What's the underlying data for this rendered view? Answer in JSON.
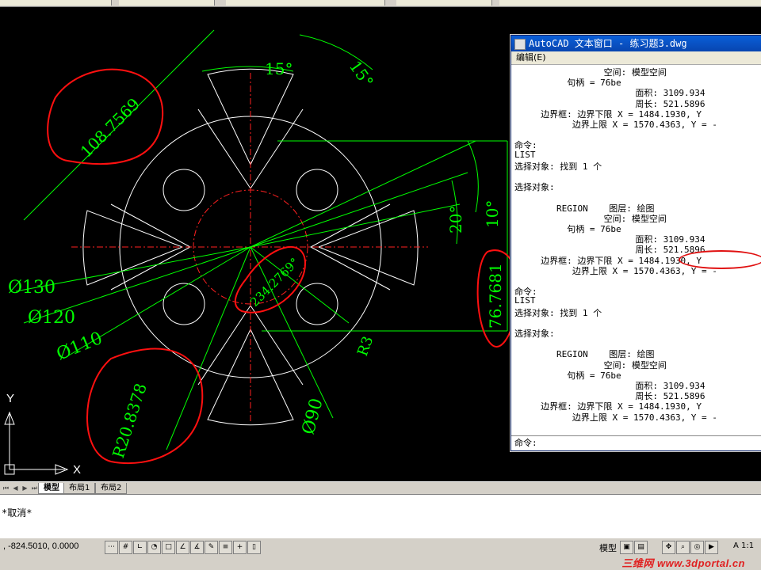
{
  "drawing": {
    "dims": {
      "d130": "Ø130",
      "d120": "Ø120",
      "d110": "Ø110",
      "d90": "Ø90",
      "r3": "R3",
      "r20": "R20.8378",
      "len108": "108.7569",
      "len234": "234.2769°",
      "len76": "76.7681",
      "ang15a": "15°",
      "ang15b": "15°",
      "ang20": "20°",
      "ang10": "10°"
    },
    "ucs": {
      "x": "X",
      "y": "Y"
    },
    "colors": {
      "geometry": "#ffffff",
      "dims": "#00ff00",
      "center": "#ff2020",
      "annot": "#ff1010"
    }
  },
  "tabs": {
    "model": "模型",
    "layout1": "布局1",
    "layout2": "布局2"
  },
  "cmdline": {
    "line1": "*取消*"
  },
  "status": {
    "coords": ", -824.5010, 0.0000",
    "model": "模型",
    "scale": "A 1:1",
    "watermark": "三维网 www.3dportal.cn"
  },
  "textwin": {
    "title": "AutoCAD 文本窗口 - 练习题3.dwg",
    "menu": "编辑(E)",
    "lines": [
      "                 空间: 模型空间",
      "          句柄 = 76be",
      "                       面积: 3109.934",
      "                       周长: 521.5896",
      "     边界框: 边界下限 X = 1484.1930, Y",
      "           边界上限 X = 1570.4363, Y = -",
      "",
      "命令:",
      "LIST",
      "选择对象: 找到 1 个",
      "",
      "选择对象:",
      "",
      "        REGION    图层: 绘图",
      "                 空间: 模型空间",
      "          句柄 = 76be",
      "                       面积: 3109.934",
      "                       周长: 521.5896",
      "     边界框: 边界下限 X = 1484.1930, Y",
      "           边界上限 X = 1570.4363, Y = -",
      "",
      "命令:",
      "LIST",
      "选择对象: 找到 1 个",
      "",
      "选择对象:",
      "",
      "        REGION    图层: 绘图",
      "                 空间: 模型空间",
      "          句柄 = 76be",
      "                       面积: 3109.934",
      "                       周长: 521.5896",
      "     边界框: 边界下限 X = 1484.1930, Y",
      "           边界上限 X = 1570.4363, Y = -"
    ],
    "prompt": "命令:"
  }
}
